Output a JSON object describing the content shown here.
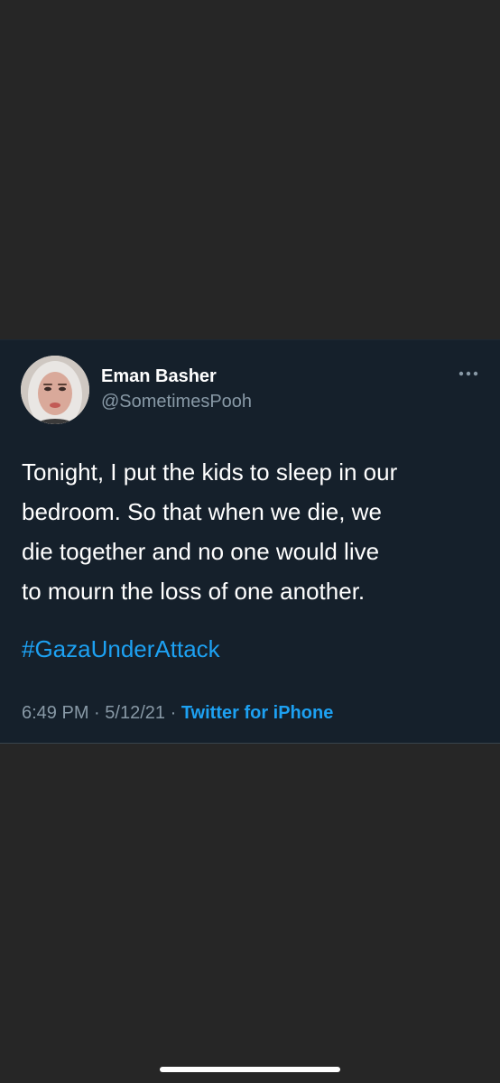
{
  "tweet": {
    "display_name": "Eman Basher",
    "handle": "@SometimesPooh",
    "text_lines": [
      "Tonight, I put the kids to sleep in our",
      "bedroom. So that when we die, we",
      "die together and no one would live",
      "to mourn the loss of one another."
    ],
    "hashtag": "#GazaUnderAttack",
    "time": "6:49 PM",
    "separator": "·",
    "date": "5/12/21",
    "source": "Twitter for iPhone"
  },
  "icons": {
    "more": "more-horizontal-icon",
    "avatar": "profile-photo"
  },
  "colors": {
    "background": "#262626",
    "card": "#15202b",
    "text": "#ffffff",
    "secondary_text": "#8899a6",
    "link": "#1da1f2"
  }
}
